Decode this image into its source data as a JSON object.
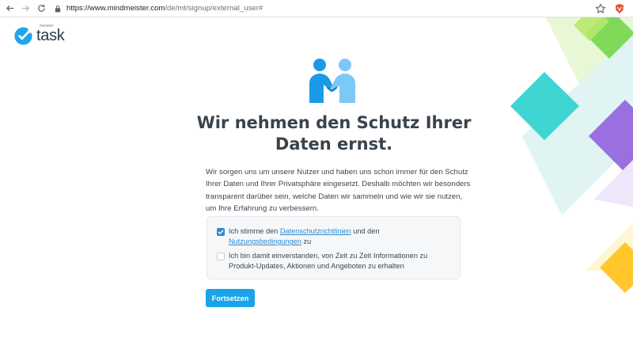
{
  "browser": {
    "url_host": "https://www.mindmeister.com",
    "url_path": "/de/mt/signup/external_user#"
  },
  "logo": {
    "small_text": "meister",
    "word": "task"
  },
  "main": {
    "title_line1": "Wir nehmen den Schutz Ihrer",
    "title_line2": "Daten ernst.",
    "intro": "Wir sorgen uns um unsere Nutzer und haben uns schon immer für den Schutz Ihrer Daten und Ihrer Privatsphäre eingesetzt. Deshalb möchten wir besonders transparent darüber sein, welche Daten wir sammeln und wie wir sie nutzen, um Ihre Erfahrung zu verbessern."
  },
  "consent": {
    "terms": {
      "checked": true,
      "text_before": "Ich stimme den ",
      "privacy_link": "Datenschutzrichtlinien",
      "text_middle": " und den ",
      "terms_link": "Nutzungsbedingungen",
      "text_after": " zu"
    },
    "newsletter": {
      "checked": false,
      "text": "Ich bin damit einverstanden, von Zeit zu Zeit Informationen zu Produkt-Updates, Aktionen und Angeboten zu erhalten"
    }
  },
  "submit_label": "Fortsetzen",
  "colors": {
    "accent": "#1aa3e9",
    "link": "#2b8ad4",
    "heading": "#3a434c"
  }
}
